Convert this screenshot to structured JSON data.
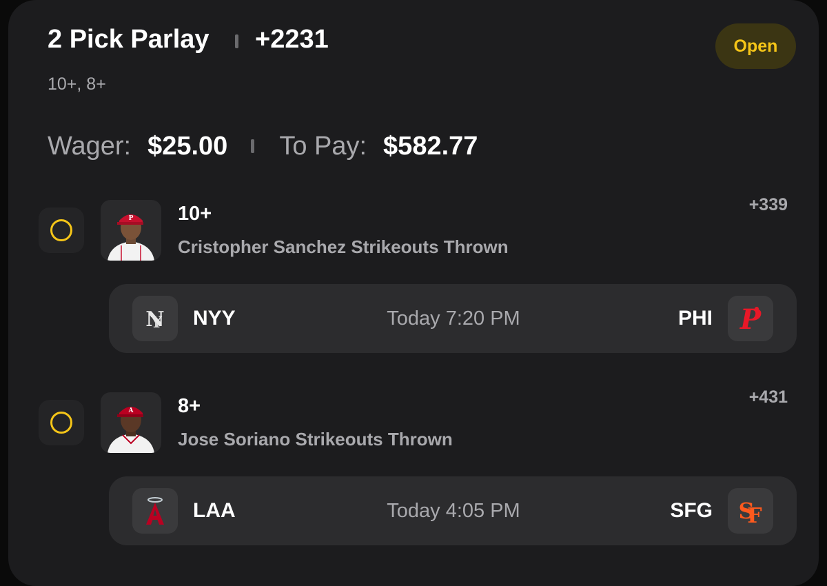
{
  "parlay": {
    "title": "2 Pick Parlay",
    "odds": "+2231",
    "status": "Open",
    "subtitle": "10+, 8+",
    "wager_label": "Wager:",
    "wager": "$25.00",
    "to_pay_label": "To Pay:",
    "to_pay": "$582.77"
  },
  "legs": [
    {
      "line": "10+",
      "market": "Cristopher Sanchez Strikeouts Thrown",
      "odds": "+339",
      "away_team": "NYY",
      "home_team": "PHI",
      "time": "Today 7:20 PM",
      "away_logo": "yankees-logo",
      "home_logo": "phillies-logo"
    },
    {
      "line": "8+",
      "market": "Jose Soriano Strikeouts Thrown",
      "odds": "+431",
      "away_team": "LAA",
      "home_team": "SFG",
      "time": "Today 4:05 PM",
      "away_logo": "angels-logo",
      "home_logo": "giants-logo"
    }
  ],
  "colors": {
    "background": "#0a0a0a",
    "card": "#1c1c1e",
    "accent_yellow": "#f5c518",
    "muted_text": "#a9a9ad",
    "game_row": "#2c2c2e"
  }
}
